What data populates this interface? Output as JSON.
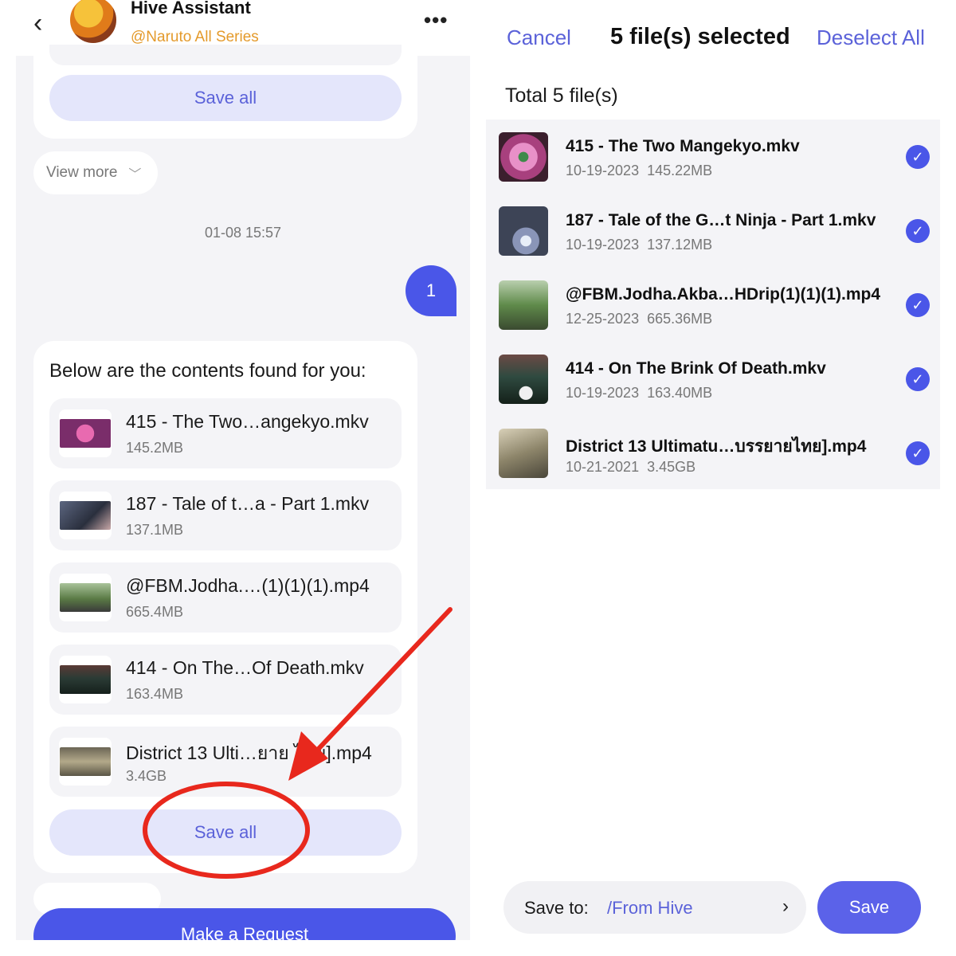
{
  "left_panel": {
    "header": {
      "back_icon": "chevron-left-icon",
      "bot_name": "Hive Assistant",
      "bot_handle": "@Naruto All Series",
      "more_icon": "more-dots-icon"
    },
    "top_card": {
      "save_all_label": "Save all"
    },
    "view_more_label": "View more",
    "timestamp": "01-08  15:57",
    "user_message": "1",
    "main_card": {
      "intro": "Below are the contents found for you:",
      "files": [
        {
          "name": "415 - The Two…angekyo.mkv",
          "size": "145.2MB",
          "thumb_color": "#7a2d6a"
        },
        {
          "name": "187 - Tale of t…a - Part 1.mkv",
          "size": "137.1MB",
          "thumb_color": "#3d4456"
        },
        {
          "name": "@FBM.Jodha.…(1)(1)(1).mp4",
          "size": "665.4MB",
          "thumb_color": "#5a7a45"
        },
        {
          "name": "414 - On The…Of Death.mkv",
          "size": "163.4MB",
          "thumb_color": "#2b3b35"
        },
        {
          "name": "District 13 Ulti…ยาย ไทย].mp4",
          "size": "3.4GB",
          "thumb_color": "#8a8064"
        }
      ],
      "save_all_label": "Save all"
    },
    "request_button_label": "Make a Request"
  },
  "right_panel": {
    "cancel_label": "Cancel",
    "title": "5 file(s) selected",
    "deselect_label": "Deselect All",
    "total_label": "Total 5 file(s)",
    "files": [
      {
        "name": "415 - The Two Mangekyo.mkv",
        "date": "10-19-2023",
        "size": "145.22MB",
        "checked": true,
        "thumb_color": "#a8407e"
      },
      {
        "name": "187 - Tale of the G…t Ninja - Part 1.mkv",
        "date": "10-19-2023",
        "size": "137.12MB",
        "checked": true,
        "thumb_color": "#3d4456"
      },
      {
        "name": "@FBM.Jodha.Akba…HDrip(1)(1)(1).mp4",
        "date": "12-25-2023",
        "size": "665.36MB",
        "checked": true,
        "thumb_color": "#5f8a4a"
      },
      {
        "name": "414 - On The Brink Of Death.mkv",
        "date": "10-19-2023",
        "size": "163.40MB",
        "checked": true,
        "thumb_color": "#2f4a40"
      },
      {
        "name": "District 13 Ultimatu…บรรยายไทย].mp4",
        "date": "10-21-2021",
        "size": "3.45GB",
        "checked": true,
        "thumb_color": "#8d856a"
      }
    ],
    "save_to_label": "Save to:",
    "save_to_path": "/From Hive",
    "save_button_label": "Save"
  },
  "colors": {
    "accent": "#4a56e8",
    "annotation": "#e8281d",
    "muted_bg": "#f4f4f7"
  }
}
